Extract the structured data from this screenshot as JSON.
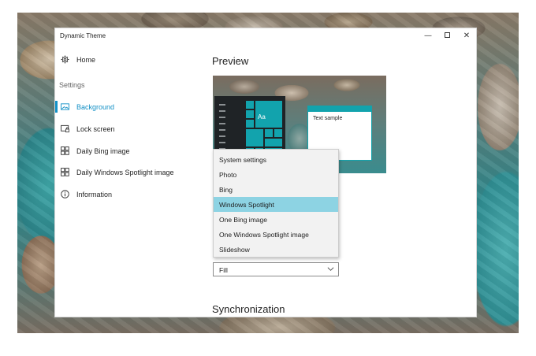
{
  "window": {
    "title": "Dynamic Theme",
    "controls": {
      "minimize": "—",
      "close": "✕"
    }
  },
  "sidebar": {
    "home": {
      "label": "Home",
      "icon": "gear-icon"
    },
    "section_heading": "Settings",
    "items": [
      {
        "label": "Background",
        "icon": "image-icon",
        "selected": true
      },
      {
        "label": "Lock screen",
        "icon": "lock-screen-icon",
        "selected": false
      },
      {
        "label": "Daily Bing image",
        "icon": "windows-grid-icon",
        "selected": false
      },
      {
        "label": "Daily Windows Spotlight image",
        "icon": "windows-grid-icon",
        "selected": false
      },
      {
        "label": "Information",
        "icon": "info-icon",
        "selected": false
      }
    ]
  },
  "main": {
    "preview_heading": "Preview",
    "preview": {
      "tile_text": "Aa",
      "window_text": "Text sample"
    },
    "dropdown": {
      "options": [
        "System settings",
        "Photo",
        "Bing",
        "Windows Spotlight",
        "One Bing image",
        "One Windows Spotlight image",
        "Slideshow"
      ],
      "selected": "Windows Spotlight"
    },
    "fit": {
      "value": "Fill"
    },
    "sync_heading": "Synchronization"
  },
  "colors": {
    "accent": "#1290c6",
    "tile": "#12a3ad",
    "selected_option": "#8dd3e3"
  }
}
